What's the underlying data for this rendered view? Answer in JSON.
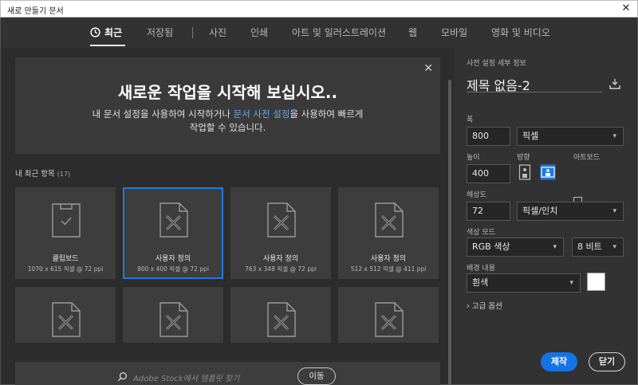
{
  "window": {
    "title": "새로 만들기 문서"
  },
  "tabs": [
    {
      "label": "최근",
      "active": true
    },
    {
      "label": "저장됨"
    },
    {
      "label": "사진"
    },
    {
      "label": "인쇄"
    },
    {
      "label": "아트 및 일러스트레이션"
    },
    {
      "label": "웹"
    },
    {
      "label": "모바일"
    },
    {
      "label": "영화 및 비디오"
    }
  ],
  "banner": {
    "title": "새로운 작업을 시작해 보십시오..",
    "desc_pre": "내 문서 설정을 사용하여 시작하거나 ",
    "desc_link": "문서 사전 설정",
    "desc_post": "을 사용하여 빠르게",
    "desc_line2": "작업할 수 있습니다."
  },
  "recent": {
    "label": "내 최근 항목",
    "count": "(17)",
    "items": [
      {
        "name": "클립보드",
        "meta": "1070 x 615 픽셀 @ 72 ppi",
        "icon": "clipboard-check-icon"
      },
      {
        "name": "사용자 정의",
        "meta": "800 x 400 픽셀 @ 72 ppi",
        "icon": "custom-doc-icon",
        "selected": true
      },
      {
        "name": "사용자 정의",
        "meta": "763 x 348 픽셀 @ 72 ppi",
        "icon": "custom-doc-icon"
      },
      {
        "name": "사용자 정의",
        "meta": "512 x 512 픽셀 @ 411 ppi",
        "icon": "custom-doc-icon"
      }
    ]
  },
  "search": {
    "placeholder_brand": "Adobe Stock",
    "placeholder_rest": "에서 템플릿 찾기",
    "go_label": "이동"
  },
  "details": {
    "section_title": "사전 설정 세부 정보",
    "doc_name": "제목 없음-2",
    "width_label": "폭",
    "width_value": "800",
    "width_unit": "픽셀",
    "height_label": "높이",
    "height_value": "400",
    "orientation_label": "방향",
    "artboard_label": "아트보드",
    "resolution_label": "해상도",
    "resolution_value": "72",
    "resolution_unit": "픽셀/인치",
    "color_mode_label": "색상 모드",
    "color_mode_value": "RGB 색상",
    "bit_depth_value": "8 비트",
    "bg_label": "배경 내용",
    "bg_value": "흰색",
    "bg_color": "#ffffff",
    "advanced_label": "고급 옵션"
  },
  "actions": {
    "create_label": "제작",
    "close_label": "닫기"
  },
  "colors": {
    "accent": "#1473e6",
    "link": "#68a8f0",
    "selected_border": "#1f7ae0"
  }
}
